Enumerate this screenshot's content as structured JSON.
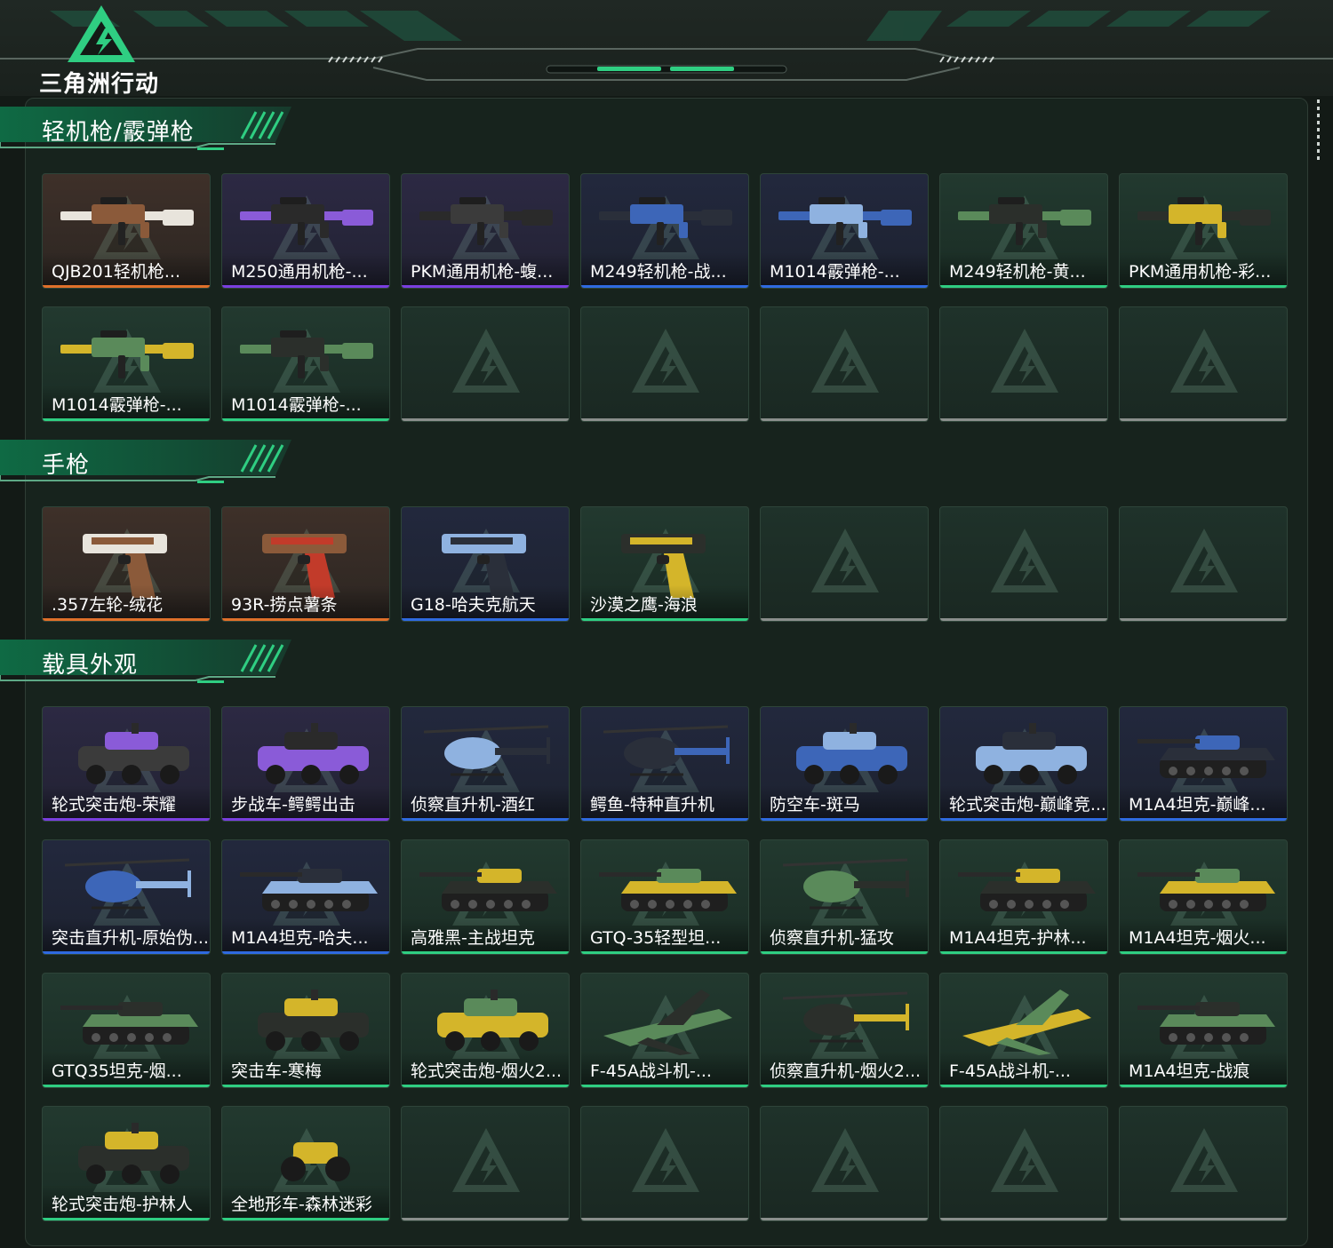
{
  "app": {
    "logo_text": "三角洲行动"
  },
  "colors": {
    "orange": "#e0702a",
    "purple": "#7a3fe0",
    "blue": "#2f6ae0",
    "green": "#2fce82",
    "empty": "#8a8f8c",
    "accent": "#2fce82"
  },
  "sections": [
    {
      "title": "轻机枪/霰弹枪",
      "items": [
        {
          "name": "QJB201轻机枪...",
          "rarity": "orange",
          "kind": "gun"
        },
        {
          "name": "M250通用机枪-...",
          "rarity": "purple",
          "kind": "gun"
        },
        {
          "name": "PKM通用机枪-蝮...",
          "rarity": "purple",
          "kind": "gun"
        },
        {
          "name": "M249轻机枪-战...",
          "rarity": "blue",
          "kind": "gun"
        },
        {
          "name": "M1014霰弹枪-...",
          "rarity": "blue",
          "kind": "gun"
        },
        {
          "name": "M249轻机枪-黄...",
          "rarity": "green",
          "kind": "gun"
        },
        {
          "name": "PKM通用机枪-彩...",
          "rarity": "green",
          "kind": "gun"
        },
        {
          "name": "M1014霰弹枪-...",
          "rarity": "green",
          "kind": "gun"
        },
        {
          "name": "M1014霰弹枪-...",
          "rarity": "green",
          "kind": "gun"
        },
        {
          "name": "",
          "rarity": "empty",
          "kind": "empty"
        },
        {
          "name": "",
          "rarity": "empty",
          "kind": "empty"
        },
        {
          "name": "",
          "rarity": "empty",
          "kind": "empty"
        },
        {
          "name": "",
          "rarity": "empty",
          "kind": "empty"
        },
        {
          "name": "",
          "rarity": "empty",
          "kind": "empty"
        }
      ]
    },
    {
      "title": "手枪",
      "items": [
        {
          "name": ".357左轮-绒花",
          "rarity": "orange",
          "kind": "pistol"
        },
        {
          "name": "93R-捞点薯条",
          "rarity": "orange",
          "kind": "pistol"
        },
        {
          "name": "G18-哈夫克航天",
          "rarity": "blue",
          "kind": "pistol"
        },
        {
          "name": "沙漠之鹰-海浪",
          "rarity": "green",
          "kind": "pistol"
        },
        {
          "name": "",
          "rarity": "empty",
          "kind": "empty"
        },
        {
          "name": "",
          "rarity": "empty",
          "kind": "empty"
        },
        {
          "name": "",
          "rarity": "empty",
          "kind": "empty"
        }
      ]
    },
    {
      "title": "载具外观",
      "items": [
        {
          "name": "轮式突击炮-荣耀",
          "rarity": "purple",
          "kind": "car"
        },
        {
          "name": "步战车-鳄鳄出击",
          "rarity": "purple",
          "kind": "car"
        },
        {
          "name": "侦察直升机-酒红",
          "rarity": "blue",
          "kind": "heli"
        },
        {
          "name": "鳄鱼-特种直升机",
          "rarity": "blue",
          "kind": "heli"
        },
        {
          "name": "防空车-斑马",
          "rarity": "blue",
          "kind": "car"
        },
        {
          "name": "轮式突击炮-巅峰竞...",
          "rarity": "blue",
          "kind": "car"
        },
        {
          "name": "M1A4坦克-巅峰...",
          "rarity": "blue",
          "kind": "tank"
        },
        {
          "name": "突击直升机-原始伪...",
          "rarity": "blue",
          "kind": "heli"
        },
        {
          "name": "M1A4坦克-哈夫...",
          "rarity": "blue",
          "kind": "tank"
        },
        {
          "name": "高雅黑-主战坦克",
          "rarity": "green",
          "kind": "tank"
        },
        {
          "name": "GTQ-35轻型坦...",
          "rarity": "green",
          "kind": "tank"
        },
        {
          "name": "侦察直升机-猛攻",
          "rarity": "green",
          "kind": "heli"
        },
        {
          "name": "M1A4坦克-护林...",
          "rarity": "green",
          "kind": "tank"
        },
        {
          "name": "M1A4坦克-烟火...",
          "rarity": "green",
          "kind": "tank"
        },
        {
          "name": "GTQ35坦克-烟...",
          "rarity": "green",
          "kind": "tank"
        },
        {
          "name": "突击车-寒梅",
          "rarity": "green",
          "kind": "car"
        },
        {
          "name": "轮式突击炮-烟火2...",
          "rarity": "green",
          "kind": "car"
        },
        {
          "name": "F-45A战斗机-...",
          "rarity": "green",
          "kind": "jet"
        },
        {
          "name": "侦察直升机-烟火2...",
          "rarity": "green",
          "kind": "heli"
        },
        {
          "name": "F-45A战斗机-...",
          "rarity": "green",
          "kind": "jet"
        },
        {
          "name": "M1A4坦克-战痕",
          "rarity": "green",
          "kind": "tank"
        },
        {
          "name": "轮式突击炮-护林人",
          "rarity": "green",
          "kind": "car"
        },
        {
          "name": "全地形车-森林迷彩",
          "rarity": "green",
          "kind": "atv"
        },
        {
          "name": "",
          "rarity": "empty",
          "kind": "empty"
        },
        {
          "name": "",
          "rarity": "empty",
          "kind": "empty"
        },
        {
          "name": "",
          "rarity": "empty",
          "kind": "empty"
        },
        {
          "name": "",
          "rarity": "empty",
          "kind": "empty"
        },
        {
          "name": "",
          "rarity": "empty",
          "kind": "empty"
        }
      ]
    }
  ]
}
